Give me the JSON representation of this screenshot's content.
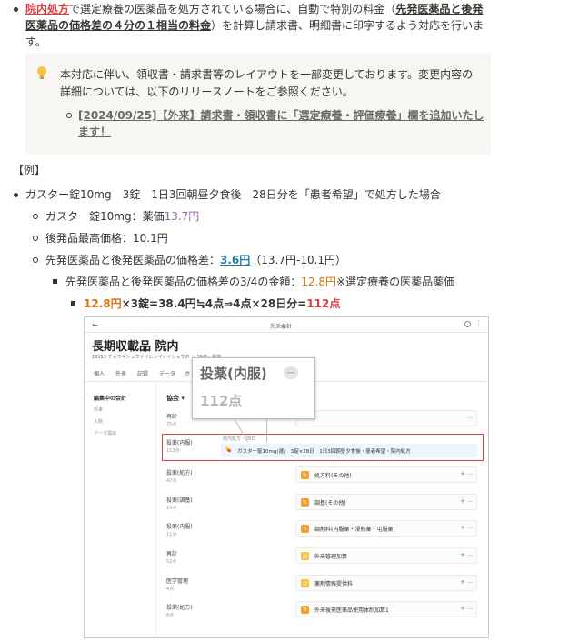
{
  "intro": {
    "link_text": "院内処方",
    "text_1": "で選定療養の医薬品を処方されている場合に、自動で特別の料金（",
    "bold_1": "先発医薬品と後発",
    "bold_2": "医薬品の価格差の４分の１相当の料金",
    "text_2": "）を計算し請求書、明細書に印字するよう対応を行いま",
    "text_3": "す。"
  },
  "callout": {
    "icon": "lightbulb-icon",
    "line_1": "本対応に伴い、領収書・請求書等のレイアウトを一部変更しております。変更内容の",
    "line_2": "詳細については、以下のリリースノートをご参照ください。",
    "link_line_1": "[2024/09/25]【外来】請求書・領収書に「選定療養・評価療養」欄を追加いたし",
    "link_line_2": "ます！"
  },
  "example_heading": "【例】",
  "example": {
    "main": "ガスター錠10mg　3錠　1日3回朝昼夕食後　28日分を「患者希望」で処方した場合",
    "price_label": "ガスター錠10mg：薬価",
    "price_value": "13.7円",
    "generic_max": "後発品最高価格：10.1円",
    "diff_label": "先発医薬品と後発医薬品の価格差：",
    "diff_value": "3.6円",
    "diff_calc": "（13.7円-10.1円）",
    "quarter_label": "先発医薬品と後発医薬品の価格差の3/4の金額：",
    "quarter_value": "12.8円",
    "quarter_note": "※選定療養の医薬品薬価",
    "calc_a": "12.8円",
    "calc_b": "×3錠=38.4円≒4点⇒4点×28日分=",
    "calc_c": "112点"
  },
  "screenshot": {
    "topbar_title": "外来会計",
    "back_arrow": "←",
    "patient_name": "長期収載品 院内",
    "patient_sub": "16113  チョウキシュウサイヒンイナイショウホ  ｜  36歳・男性",
    "tabs": [
      "個人",
      "外来",
      "記録",
      "データ",
      "ボ"
    ],
    "sidebar": [
      "編集中の会計",
      "外来",
      "入院",
      "データ提出"
    ],
    "insurance": "協会",
    "popup_title": "投薬(内服)",
    "popup_points": "112点",
    "rows": [
      {
        "cat": "再診",
        "pts": "75点",
        "item": ""
      },
      {
        "cat": "投薬(内服)",
        "pts": "112点",
        "item": "ガスター錠10mg(選)　3錠×28日　1日3回朝昼夕食後・患者希望・院内処方"
      },
      {
        "cat": "投薬(処方)",
        "pts": "42点",
        "item": "処方料(その他)"
      },
      {
        "cat": "投薬(調基)",
        "pts": "14点",
        "item": "調基(その他)"
      },
      {
        "cat": "投薬(内服)",
        "pts": "11点",
        "item": "調剤料(内服薬・浸煎薬・屯服薬)"
      },
      {
        "cat": "再診",
        "pts": "52点",
        "item": "外来管理加算"
      },
      {
        "cat": "医学管理",
        "pts": "4点",
        "item": "薬剤情報提供料"
      },
      {
        "cat": "投薬(処方)",
        "pts": "8点",
        "item": "外来後発医薬品使用体制加算1"
      }
    ],
    "row_note": "院内処方・28日",
    "highlight_color": "#e03e3e"
  }
}
